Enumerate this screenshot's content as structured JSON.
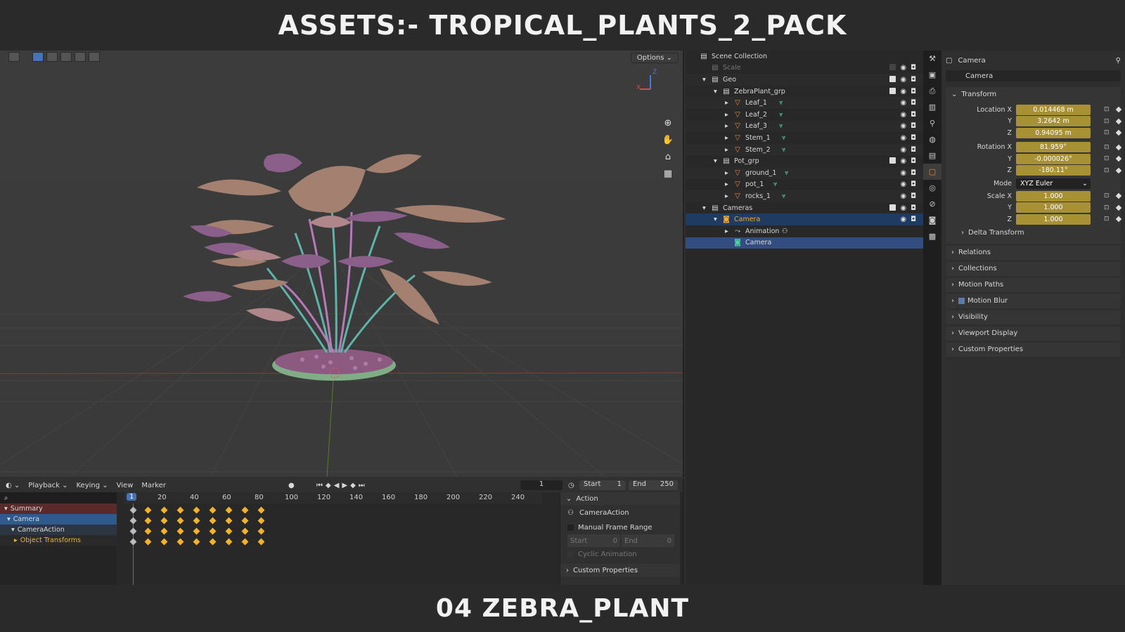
{
  "banner": {
    "top": "ASSETS:- TROPICAL_PLANTS_2_PACK",
    "bottom": "04 ZEBRA_PLANT"
  },
  "viewport": {
    "options_label": "Options",
    "gizmo_x": "X",
    "gizmo_z": "Z",
    "tools": [
      "zoom-icon",
      "hand-icon",
      "camera-view-icon",
      "grid-icon"
    ]
  },
  "timeline": {
    "menu": [
      "Playback",
      "Keying",
      "View",
      "Marker"
    ],
    "current_frame": "1",
    "start_label": "Start",
    "start_value": "1",
    "end_label": "End",
    "end_value": "250",
    "ruler": [
      "1",
      "20",
      "40",
      "60",
      "80",
      "100",
      "120",
      "140",
      "160",
      "180",
      "200",
      "220",
      "240"
    ],
    "channels": [
      "Summary",
      "Camera",
      "CameraAction",
      "Object Transforms"
    ],
    "keyframe_frames": [
      1,
      10,
      20,
      30,
      40,
      50,
      60,
      70,
      80
    ],
    "action_panel": {
      "title": "Action",
      "action_name": "CameraAction",
      "manual_range": "Manual Frame Range",
      "start_label": "Start",
      "start_value": "0",
      "end_label": "End",
      "end_value": "0",
      "cyclic": "Cyclic Animation",
      "custom_props": "Custom Properties"
    }
  },
  "outliner": {
    "title": "Scene Collection",
    "rows": [
      {
        "label": "Scale",
        "indent": 1
      },
      {
        "label": "Geo",
        "indent": 1
      },
      {
        "label": "ZebraPlant_grp",
        "indent": 2
      },
      {
        "label": "Leaf_1",
        "indent": 3
      },
      {
        "label": "Leaf_2",
        "indent": 3
      },
      {
        "label": "Leaf_3",
        "indent": 3
      },
      {
        "label": "Stem_1",
        "indent": 3
      },
      {
        "label": "Stem_2",
        "indent": 3
      },
      {
        "label": "Pot_grp",
        "indent": 2
      },
      {
        "label": "ground_1",
        "indent": 3
      },
      {
        "label": "pot_1",
        "indent": 3
      },
      {
        "label": "rocks_1",
        "indent": 3
      },
      {
        "label": "Cameras",
        "indent": 1
      },
      {
        "label": "Camera",
        "indent": 2
      },
      {
        "label": "Animation",
        "indent": 3
      },
      {
        "label": "Camera",
        "indent": 3
      }
    ]
  },
  "properties": {
    "header": "Camera",
    "object_name": "Camera",
    "transform_title": "Transform",
    "location_x_label": "Location X",
    "location_x": "0.014468 m",
    "y_label": "Y",
    "z_label": "Z",
    "location_y": "3.2642 m",
    "location_z": "0.94095 m",
    "rotation_x_label": "Rotation X",
    "rotation_x": "81.959°",
    "rotation_y": "-0.000026°",
    "rotation_z": "-180.11°",
    "mode_label": "Mode",
    "mode_value": "XYZ Euler",
    "scale_x_label": "Scale X",
    "scale_x": "1.000",
    "scale_y": "1.000",
    "scale_z": "1.000",
    "delta": "Delta Transform",
    "panels": [
      "Relations",
      "Collections",
      "Motion Paths",
      "Motion Blur",
      "Visibility",
      "Viewport Display",
      "Custom Properties"
    ]
  }
}
